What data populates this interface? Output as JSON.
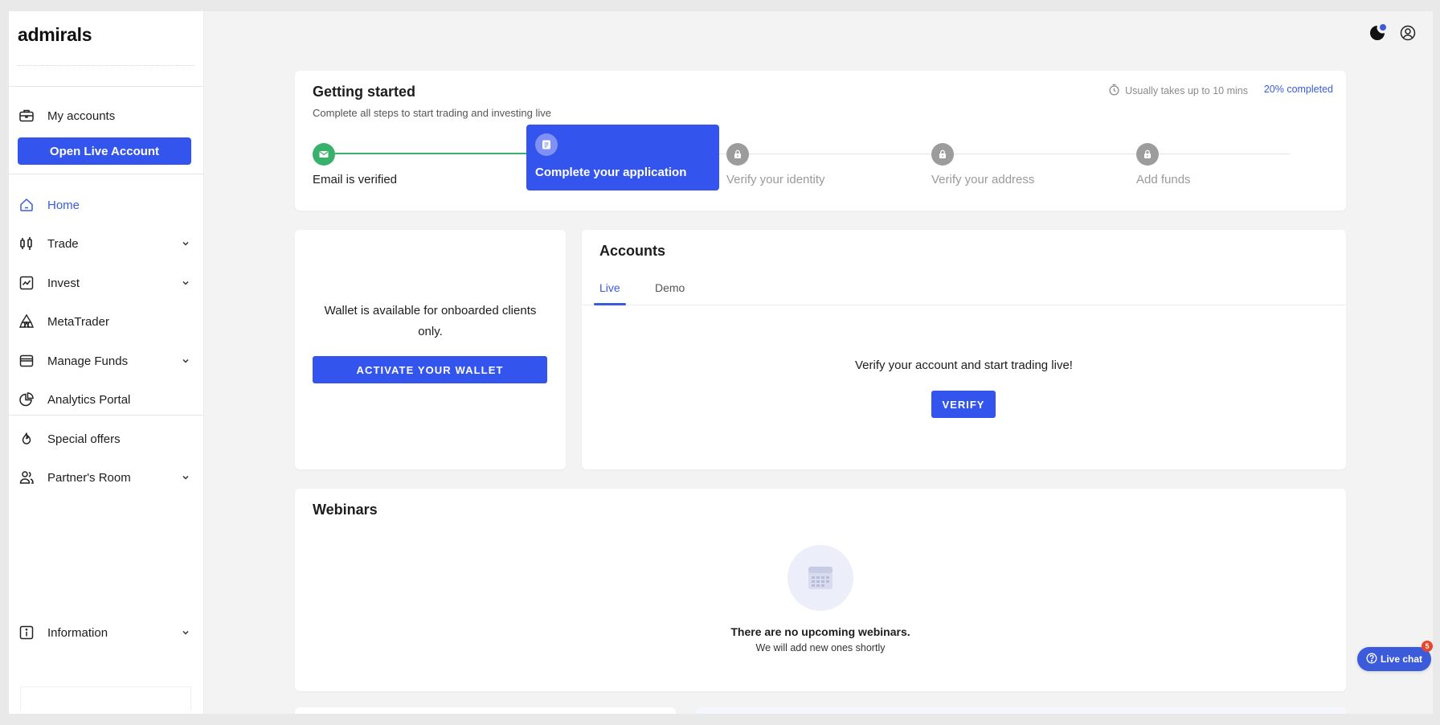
{
  "brand": {
    "logo_text": "admirals"
  },
  "sidebar": {
    "my_accounts": "My accounts",
    "open_live_button": "Open Live Account",
    "items": [
      {
        "label": "Home",
        "icon": "home-icon",
        "active": true,
        "chevron": false
      },
      {
        "label": "Trade",
        "icon": "candlestick-icon",
        "active": false,
        "chevron": true
      },
      {
        "label": "Invest",
        "icon": "chart-line-icon",
        "active": false,
        "chevron": true
      },
      {
        "label": "MetaTrader",
        "icon": "metatrader-icon",
        "active": false,
        "chevron": false
      },
      {
        "label": "Manage Funds",
        "icon": "wallet-icon",
        "active": false,
        "chevron": true
      },
      {
        "label": "Analytics Portal",
        "icon": "pie-chart-icon",
        "active": false,
        "chevron": false
      }
    ],
    "special_offers": "Special offers",
    "partners_room": "Partner's Room",
    "information": "Information"
  },
  "getting_started": {
    "title": "Getting started",
    "subtitle": "Complete all steps to start trading and investing live",
    "time_note": "Usually takes up to 10 mins",
    "progress_text": "20% completed",
    "progress": 0.2,
    "steps": [
      {
        "label": "Email is verified",
        "state": "done"
      },
      {
        "label": "Complete your application",
        "state": "active"
      },
      {
        "label": "Verify your identity",
        "state": "locked"
      },
      {
        "label": "Verify your address",
        "state": "locked"
      },
      {
        "label": "Add funds",
        "state": "locked"
      }
    ]
  },
  "wallet": {
    "message": "Wallet is available for onboarded clients only.",
    "button": "ACTIVATE YOUR WALLET"
  },
  "accounts": {
    "title": "Accounts",
    "tabs": [
      "Live",
      "Demo"
    ],
    "selected_tab": "Live",
    "message": "Verify your account and start trading live!",
    "button": "VERIFY"
  },
  "webinars": {
    "title": "Webinars",
    "empty_title": "There are no upcoming webinars.",
    "empty_subtitle": "We will add new ones shortly"
  },
  "live_chat": {
    "label": "Live chat",
    "badge": "5"
  },
  "colors": {
    "accent": "#3355ee",
    "success": "#38b26b",
    "locked": "#9c9c9c",
    "badge": "#e8452c"
  }
}
